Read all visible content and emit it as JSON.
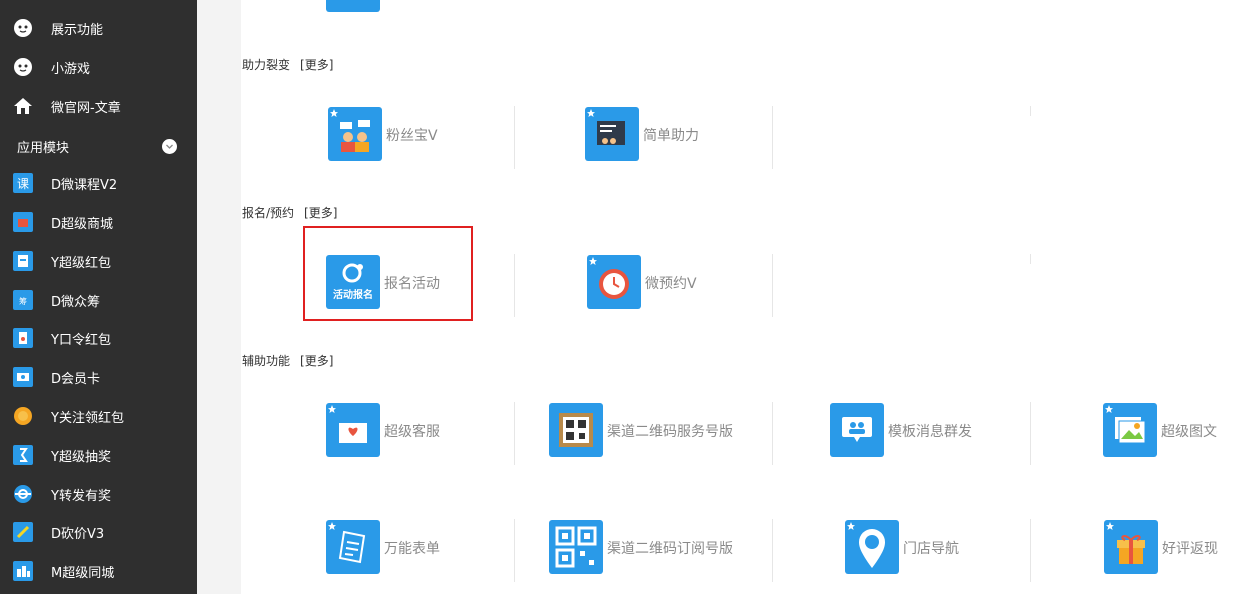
{
  "sidebar": {
    "items": [
      {
        "label": "展示功能",
        "icon": "circle-face-icon"
      },
      {
        "label": "小游戏",
        "icon": "circle-face-icon"
      },
      {
        "label": "微官网-文章",
        "icon": "home-icon"
      }
    ],
    "section_label": "应用模块",
    "modules": [
      {
        "label": "D微课程V2",
        "icon": "course-icon"
      },
      {
        "label": "D超级商城",
        "icon": "mall-icon"
      },
      {
        "label": "Y超级红包",
        "icon": "redpacket-icon"
      },
      {
        "label": "D微众筹",
        "icon": "crowdfund-icon"
      },
      {
        "label": "Y口令红包",
        "icon": "password-redpacket-icon"
      },
      {
        "label": "D会员卡",
        "icon": "member-card-icon"
      },
      {
        "label": "Y关注领红包",
        "icon": "follow-redpacket-icon"
      },
      {
        "label": "Y超级抽奖",
        "icon": "lottery-icon"
      },
      {
        "label": "Y转发有奖",
        "icon": "share-reward-icon"
      },
      {
        "label": "D砍价V3",
        "icon": "bargain-icon"
      },
      {
        "label": "M超级同城",
        "icon": "city-icon"
      }
    ]
  },
  "groups": {
    "fission": {
      "title": "助力裂变",
      "more": "[更多]",
      "apps": [
        {
          "label": "粉丝宝V"
        },
        {
          "label": "简单助力"
        }
      ]
    },
    "signup": {
      "title": "报名/预约",
      "more": "[更多]",
      "apps": [
        {
          "label": "报名活动",
          "icon_text": "活动报名"
        },
        {
          "label": "微预约V"
        }
      ]
    },
    "aux": {
      "title": "辅助功能",
      "more": "[更多]",
      "apps": [
        {
          "label": "超级客服"
        },
        {
          "label": "渠道二维码服务号版"
        },
        {
          "label": "模板消息群发"
        },
        {
          "label": "超级图文"
        },
        {
          "label": "万能表单"
        },
        {
          "label": "渠道二维码订阅号版"
        },
        {
          "label": "门店导航"
        },
        {
          "label": "好评返现"
        }
      ]
    }
  },
  "colors": {
    "sidebar_bg": "#2f2f2f",
    "app_blue": "#2a9ae8",
    "highlight": "#e02020"
  }
}
